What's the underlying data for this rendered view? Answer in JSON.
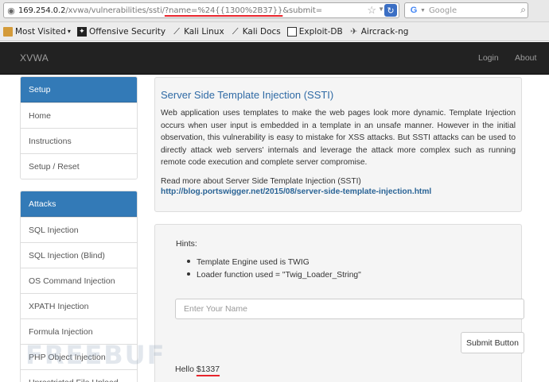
{
  "browser": {
    "url_host": "169.254.0.2",
    "url_path": "/xvwa/vulnerabilities/ssti/",
    "url_query": "?name=%24{{1300%2B37}}",
    "url_rest": "&submit=",
    "search_placeholder": "Google",
    "bookmarks": [
      {
        "label": "Most Visited",
        "icon": "folder-icon",
        "caret": "▾"
      },
      {
        "label": "Offensive Security",
        "icon": "offsec-icon"
      },
      {
        "label": "Kali Linux",
        "icon": "kali-dragon-icon"
      },
      {
        "label": "Kali Docs",
        "icon": "kali-dragon-icon"
      },
      {
        "label": "Exploit-DB",
        "icon": "exploit-db-icon"
      },
      {
        "label": "Aircrack-ng",
        "icon": "aircrack-icon"
      }
    ]
  },
  "navbar": {
    "brand": "XVWA",
    "login": "Login",
    "about": "About"
  },
  "sidebar": {
    "setup": {
      "heading": "Setup",
      "items": [
        "Home",
        "Instructions",
        "Setup / Reset"
      ]
    },
    "attacks": {
      "heading": "Attacks",
      "items": [
        "SQL Injection",
        "SQL Injection (Blind)",
        "OS Command Injection",
        "XPATH Injection",
        "Formula Injection",
        "PHP Object Injection",
        "Unrestricted File Upload"
      ]
    }
  },
  "main": {
    "title": "Server Side Template Injection (SSTI)",
    "description": "Web application uses templates to make the web pages look more dynamic. Template Injection occurs when user input is embedded in a template in an unsafe manner. However in the initial observation, this vulnerability is easy to mistake for XSS attacks. But SSTI attacks can be used to directly attack web servers' internals and leverage the attack more complex such as running remote code execution and complete server compromise.",
    "read_more": "Read more about Server Side Template Injection (SSTI)",
    "link": "http://blog.portswigger.net/2015/08/server-side-template-injection.html"
  },
  "form": {
    "hints_label": "Hints:",
    "hints": [
      "Template Engine used is TWIG",
      "Loader function used = \"Twig_Loader_String\""
    ],
    "name_placeholder": "Enter Your Name",
    "submit_label": "Submit Button",
    "result_prefix": "Hello ",
    "result_value": "$1337"
  },
  "watermark": "FREEBUF"
}
